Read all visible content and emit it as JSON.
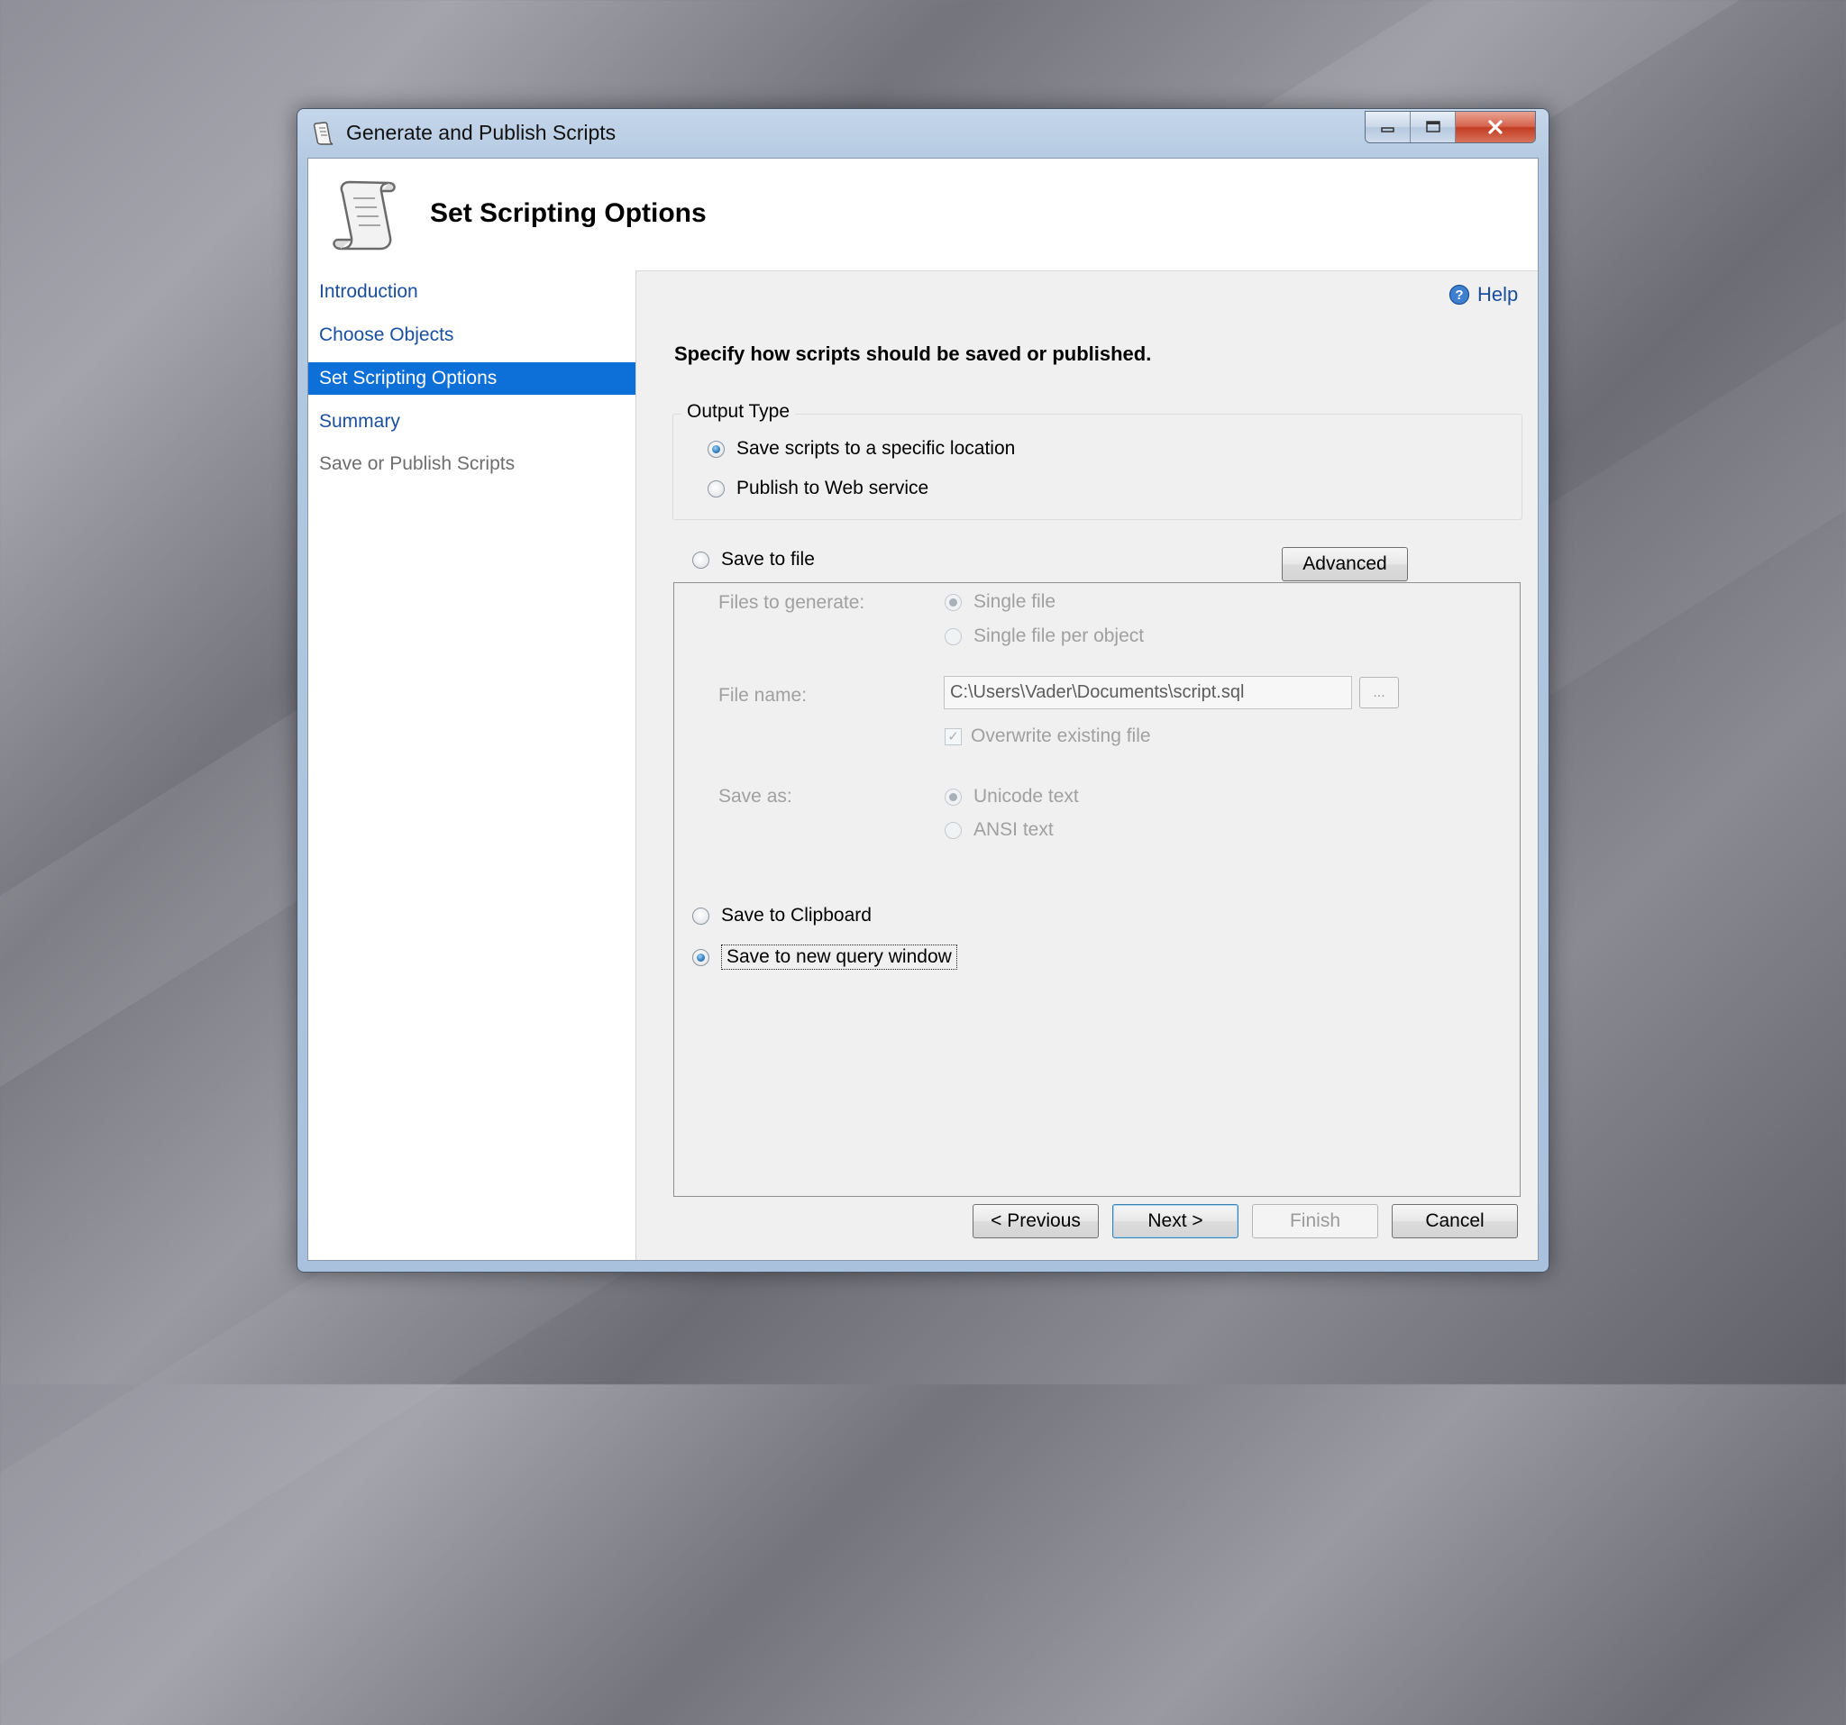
{
  "window": {
    "title": "Generate and Publish Scripts"
  },
  "header": {
    "title": "Set Scripting Options"
  },
  "nav": {
    "items": [
      {
        "label": "Introduction",
        "state": "link"
      },
      {
        "label": "Choose Objects",
        "state": "link"
      },
      {
        "label": "Set Scripting Options",
        "state": "selected"
      },
      {
        "label": "Summary",
        "state": "link"
      },
      {
        "label": "Save or Publish Scripts",
        "state": "disabled"
      }
    ]
  },
  "help": {
    "label": "Help"
  },
  "instruction": "Specify how scripts should be saved or published.",
  "output_type": {
    "legend": "Output Type",
    "options": [
      {
        "label": "Save scripts to a specific location",
        "checked": true
      },
      {
        "label": "Publish to Web service",
        "checked": false
      }
    ]
  },
  "destination": {
    "save_to_file": {
      "label": "Save to file",
      "checked": false
    },
    "advanced_button": "Advanced",
    "files_to_generate": {
      "label": "Files to generate:",
      "options": [
        {
          "label": "Single file",
          "checked": true
        },
        {
          "label": "Single file per object",
          "checked": false
        }
      ]
    },
    "file_name": {
      "label": "File name:",
      "value": "C:\\Users\\Vader\\Documents\\script.sql",
      "browse_label": "..."
    },
    "overwrite": {
      "label": "Overwrite existing file",
      "checked": true
    },
    "save_as": {
      "label": "Save as:",
      "options": [
        {
          "label": "Unicode text",
          "checked": true
        },
        {
          "label": "ANSI text",
          "checked": false
        }
      ]
    },
    "save_to_clipboard": {
      "label": "Save to Clipboard",
      "checked": false
    },
    "save_to_query_window": {
      "label": "Save to new query window",
      "checked": true
    }
  },
  "buttons": {
    "previous": "< Previous",
    "next": "Next >",
    "finish": "Finish",
    "cancel": "Cancel"
  },
  "icons": {
    "app": "script-scroll-icon",
    "help": "help-question-icon",
    "minimize": "minimize-icon",
    "maximize": "maximize-icon",
    "close": "close-icon"
  }
}
